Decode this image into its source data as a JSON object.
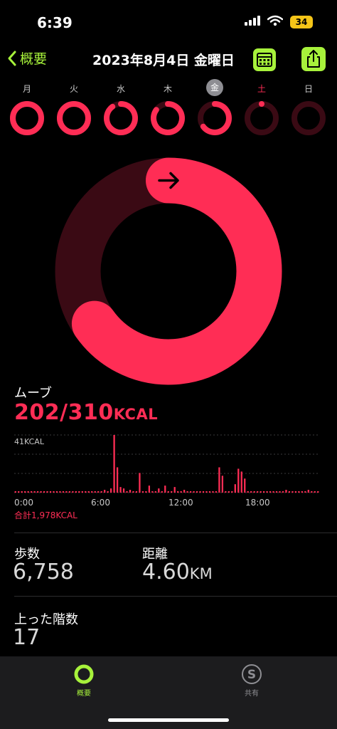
{
  "status": {
    "time": "6:39",
    "battery": "34"
  },
  "nav": {
    "back_label": "概要",
    "title": "2023年8月4日 金曜日"
  },
  "week": {
    "days": [
      {
        "label": "月",
        "progress": 1.0
      },
      {
        "label": "火",
        "progress": 1.0
      },
      {
        "label": "水",
        "progress": 0.9
      },
      {
        "label": "木",
        "progress": 0.85
      },
      {
        "label": "金",
        "progress": 0.65
      },
      {
        "label": "土",
        "progress": 0.03
      },
      {
        "label": "日",
        "progress": 0.0
      }
    ],
    "selected_index": 4,
    "today_index": 5
  },
  "ring": {
    "progress": 0.652
  },
  "move": {
    "label": "ムーブ",
    "value": "202/310",
    "unit": "KCAL",
    "chart_max_label": "41KCAL",
    "x_ticks": [
      "0:00",
      "6:00",
      "12:00",
      "18:00"
    ],
    "total": "合計1,978KCAL"
  },
  "chart_data": {
    "type": "bar",
    "x": [
      "0:00",
      "0:15",
      "0:30",
      "0:45",
      "1:00",
      "1:15",
      "1:30",
      "1:45",
      "2:00",
      "2:15",
      "2:30",
      "2:45",
      "3:00",
      "3:15",
      "3:30",
      "3:45",
      "4:00",
      "4:15",
      "4:30",
      "4:45",
      "5:00",
      "5:15",
      "5:30",
      "5:45",
      "6:00",
      "6:15",
      "6:30",
      "6:45",
      "7:00",
      "7:15",
      "7:30",
      "7:45",
      "8:00",
      "8:15",
      "8:30",
      "8:45",
      "9:00",
      "9:15",
      "9:30",
      "9:45",
      "10:00",
      "10:15",
      "10:30",
      "10:45",
      "11:00",
      "11:15",
      "11:30",
      "11:45",
      "12:00",
      "12:15",
      "12:30",
      "12:45",
      "13:00",
      "13:15",
      "13:30",
      "13:45",
      "14:00",
      "14:15",
      "14:30",
      "14:45",
      "15:00",
      "15:15",
      "15:30",
      "15:45",
      "16:00",
      "16:15",
      "16:30",
      "16:45",
      "17:00",
      "17:15",
      "17:30",
      "17:45",
      "18:00",
      "18:15",
      "18:30",
      "18:45",
      "19:00",
      "19:15",
      "19:30",
      "19:45",
      "20:00",
      "20:15",
      "20:30",
      "20:45",
      "21:00",
      "21:15",
      "21:30",
      "21:45",
      "22:00",
      "22:15",
      "22:30",
      "22:45",
      "23:00",
      "23:15",
      "23:30",
      "23:45"
    ],
    "values": [
      1,
      1,
      1,
      1,
      1,
      1,
      1,
      1,
      1,
      1,
      1,
      1,
      1,
      1,
      1,
      1,
      1,
      1,
      1,
      1,
      1,
      1,
      1,
      1,
      1,
      1,
      1,
      1,
      2,
      1,
      3,
      41,
      18,
      4,
      3,
      1,
      2,
      1,
      1,
      14,
      1,
      1,
      5,
      1,
      1,
      3,
      1,
      5,
      1,
      1,
      4,
      1,
      1,
      2,
      1,
      1,
      1,
      1,
      1,
      1,
      1,
      1,
      1,
      1,
      18,
      12,
      1,
      1,
      1,
      6,
      17,
      15,
      10,
      1,
      1,
      1,
      1,
      1,
      1,
      1,
      1,
      1,
      1,
      1,
      1,
      2,
      1,
      1,
      1,
      1,
      1,
      1,
      2,
      1,
      1,
      1
    ],
    "ylim": [
      0,
      41
    ],
    "color": "#ff2d55"
  },
  "stats": {
    "steps_label": "歩数",
    "steps_value": "6,758",
    "distance_label": "距離",
    "distance_value": "4.60",
    "distance_unit": "KM",
    "floors_label": "上った階数",
    "floors_value": "17"
  },
  "tabs": [
    {
      "label": "概要",
      "active": true
    },
    {
      "label": "共有",
      "active": false
    }
  ],
  "colors": {
    "accent": "#a7f23b",
    "move": "#ff2d55",
    "move_dim": "#3a0a14"
  }
}
